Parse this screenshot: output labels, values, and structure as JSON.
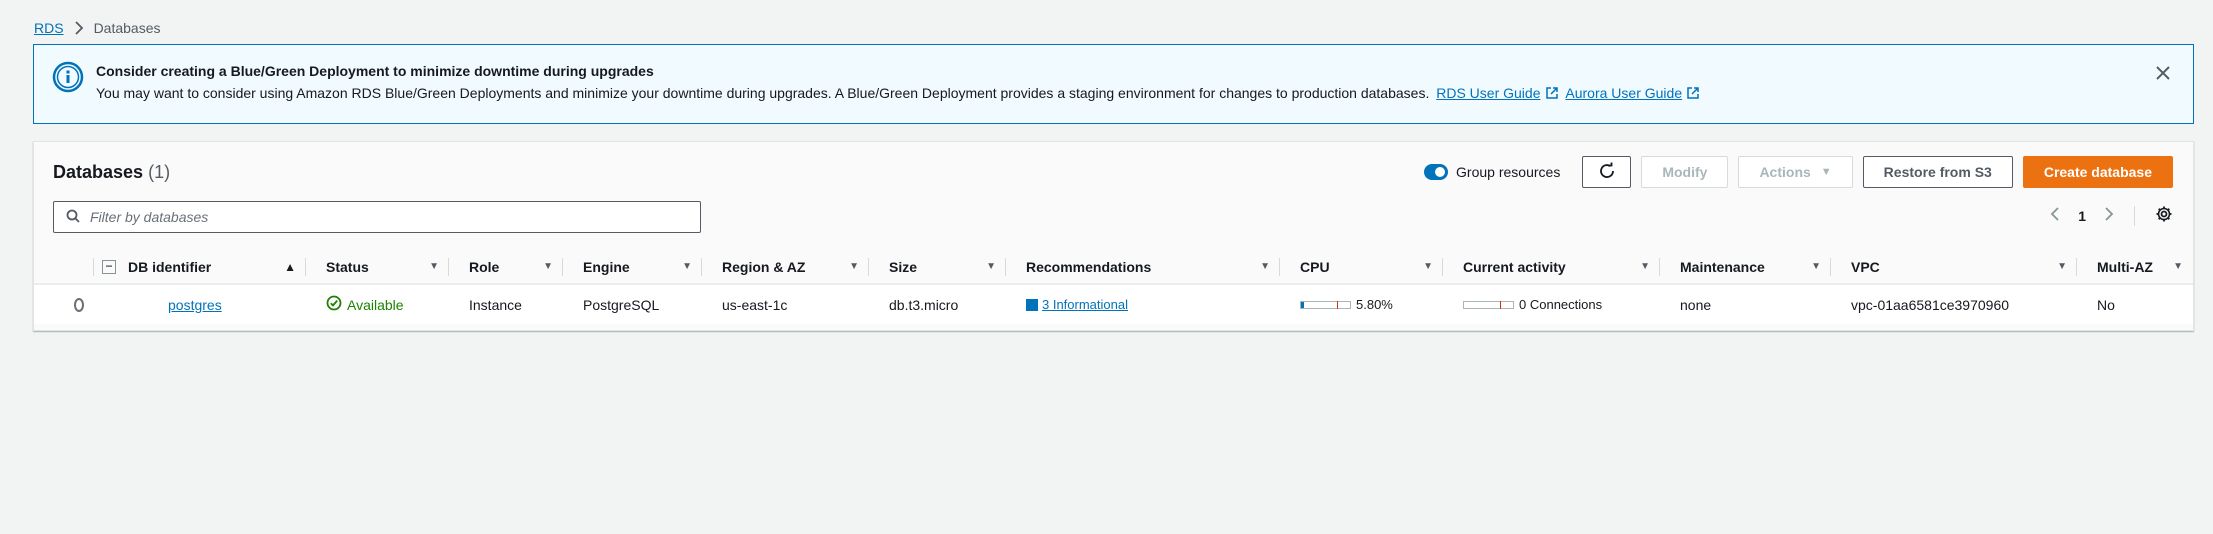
{
  "breadcrumb": {
    "root": "RDS",
    "current": "Databases"
  },
  "banner": {
    "title": "Consider creating a Blue/Green Deployment to minimize downtime during upgrades",
    "body": "You may want to consider using Amazon RDS Blue/Green Deployments and minimize your downtime during upgrades. A Blue/Green Deployment provides a staging environment for changes to production databases.",
    "link_rds": "RDS User Guide",
    "link_aurora": "Aurora User Guide"
  },
  "panel": {
    "title": "Databases",
    "count": "(1)",
    "group_resources_label": "Group resources",
    "group_resources_on": true,
    "modify_label": "Modify",
    "actions_label": "Actions",
    "restore_label": "Restore from S3",
    "create_label": "Create database",
    "filter_placeholder": "Filter by databases",
    "page_number": "1"
  },
  "table": {
    "headers": {
      "id": "DB identifier",
      "status": "Status",
      "role": "Role",
      "engine": "Engine",
      "region": "Region & AZ",
      "size": "Size",
      "recommendations": "Recommendations",
      "cpu": "CPU",
      "activity": "Current activity",
      "maintenance": "Maintenance",
      "vpc": "VPC",
      "multi_az": "Multi-AZ"
    },
    "rows": [
      {
        "id": "postgres",
        "status": "Available",
        "role": "Instance",
        "engine": "PostgreSQL",
        "region": "us-east-1c",
        "size": "db.t3.micro",
        "recommendations": "3 Informational",
        "cpu": "5.80%",
        "cpu_fraction": 0.058,
        "activity": "0 Connections",
        "activity_fraction": 0,
        "maintenance": "none",
        "vpc": "vpc-01aa6581ce3970960",
        "multi_az": "No"
      }
    ]
  },
  "colors": {
    "accent": "#0073bb",
    "primary_button": "#ec7211",
    "success": "#1d8102",
    "banner_bg": "#f1faff"
  }
}
